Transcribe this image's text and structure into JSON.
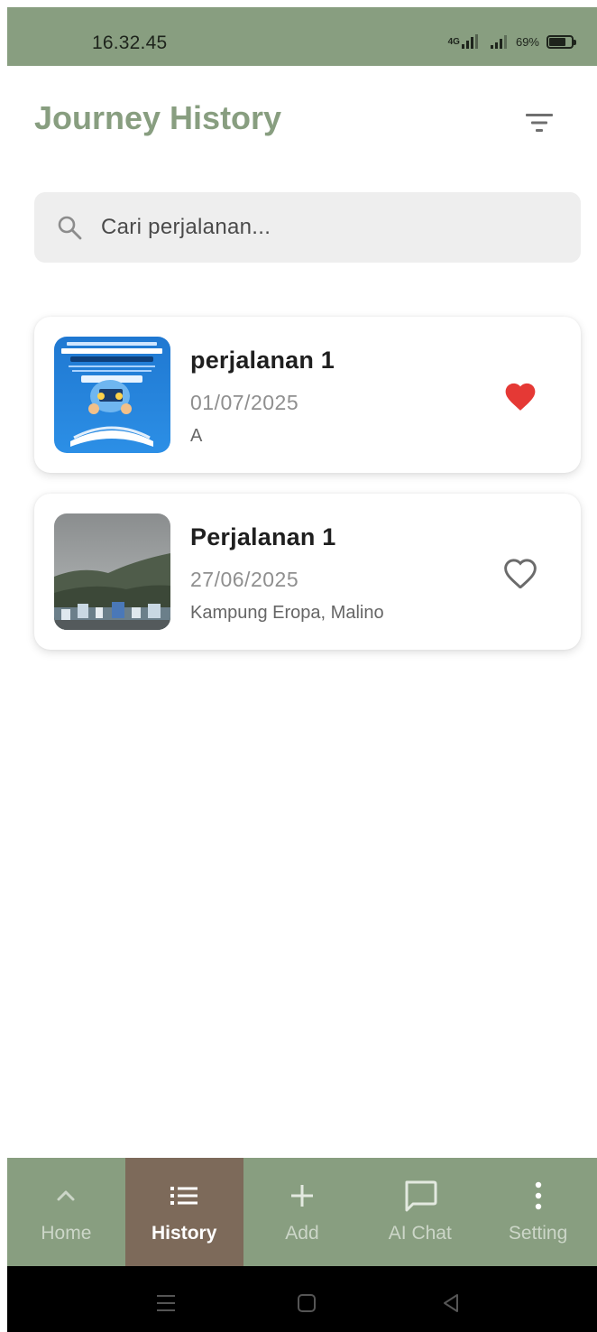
{
  "status_bar": {
    "time": "16.32.45",
    "network": "4G",
    "battery": "69%"
  },
  "header": {
    "title": "Journey History",
    "filter_icon": "filter-list-icon"
  },
  "search": {
    "placeholder": "Cari perjalanan...",
    "value": "",
    "icon": "search-icon"
  },
  "journeys": [
    {
      "title": "perjalanan 1",
      "date": "01/07/2025",
      "location": "A",
      "favorite": true,
      "favorite_color": "#e53935"
    },
    {
      "title": "Perjalanan 1",
      "date": "27/06/2025",
      "location": "Kampung Eropa, Malino",
      "favorite": false
    }
  ],
  "bottom_nav": {
    "items": [
      {
        "label": "Home",
        "icon": "chevron-up-icon",
        "active": false
      },
      {
        "label": "History",
        "icon": "list-icon",
        "active": true
      },
      {
        "label": "Add",
        "icon": "plus-icon",
        "active": false
      },
      {
        "label": "AI Chat",
        "icon": "chat-bubble-icon",
        "active": false
      },
      {
        "label": "Setting",
        "icon": "more-vertical-icon",
        "active": false
      }
    ]
  },
  "colors": {
    "primary": "#889e80",
    "active_nav": "#7d6a5a",
    "favorite": "#e53935"
  }
}
